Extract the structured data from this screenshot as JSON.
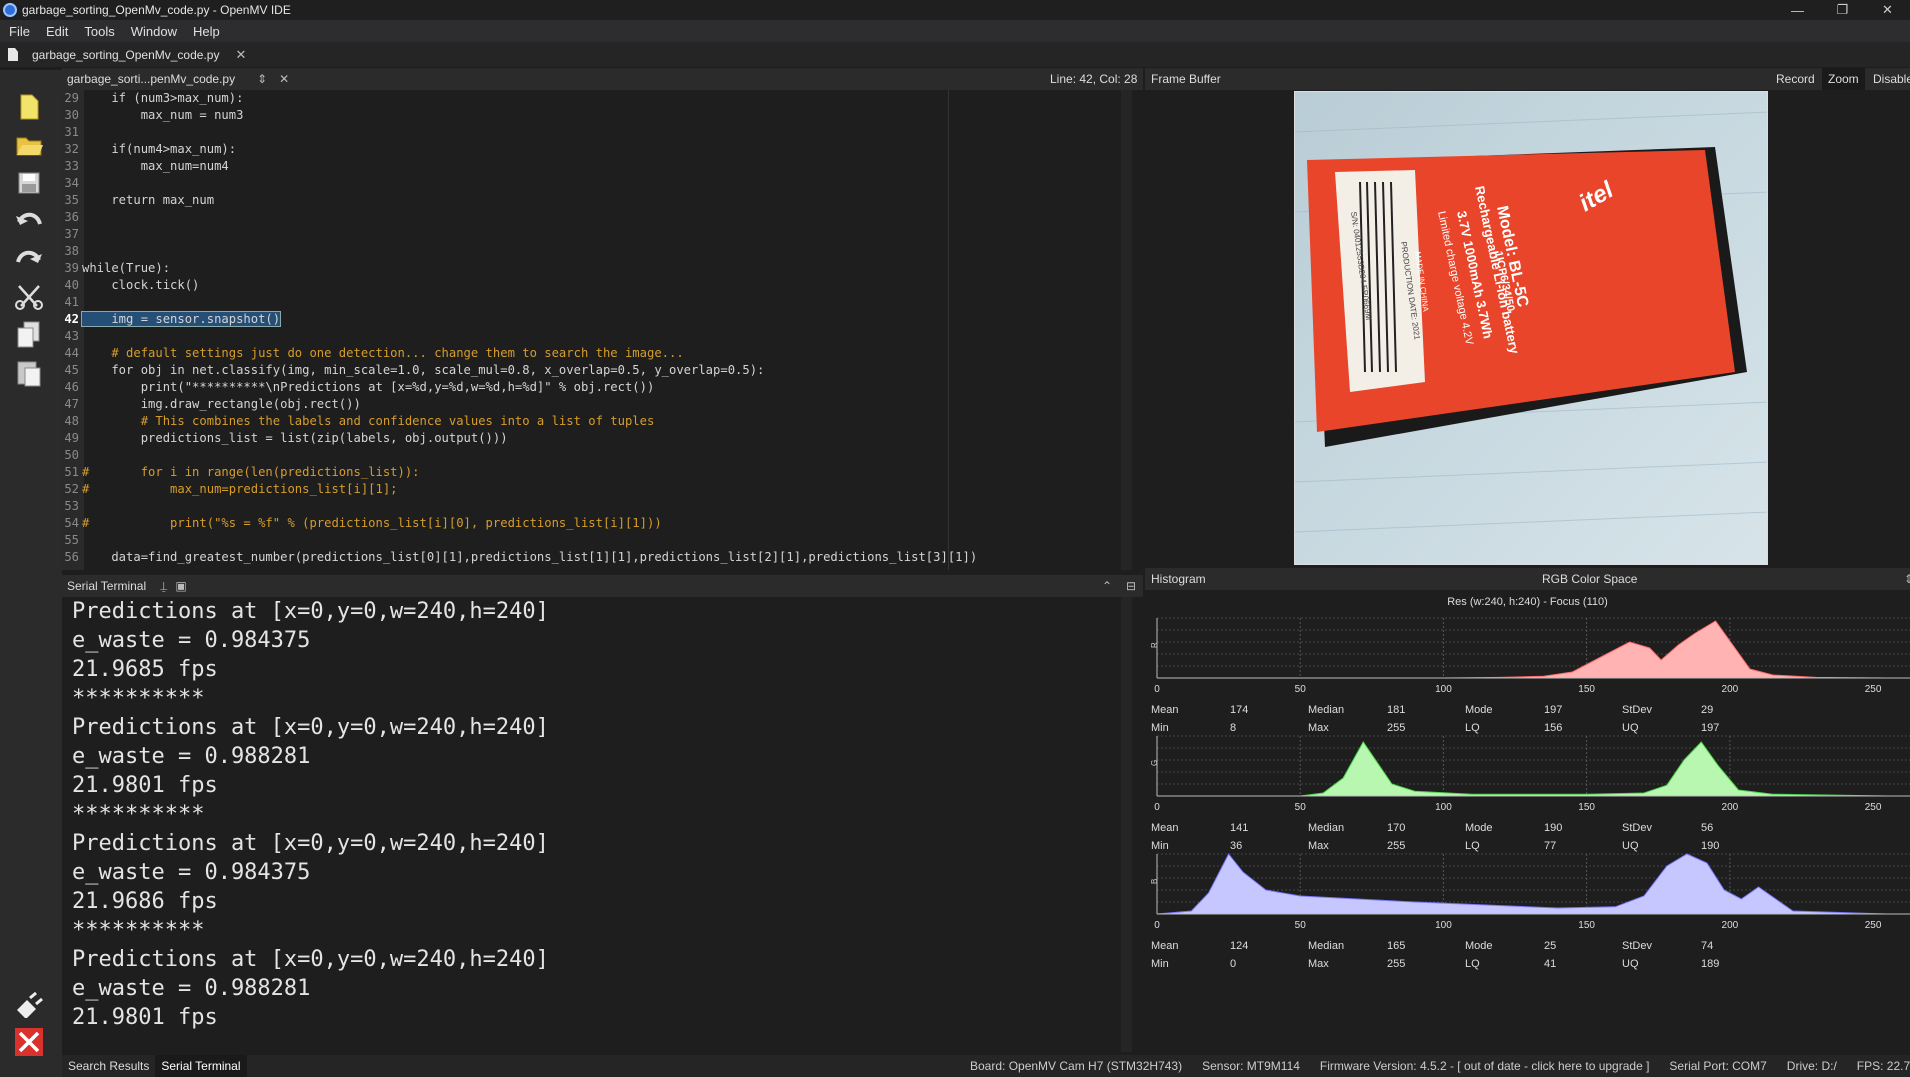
{
  "window": {
    "title": "garbage_sorting_OpenMv_code.py - OpenMV IDE",
    "min": "—",
    "max": "❐",
    "close": "✕"
  },
  "menu": [
    "File",
    "Edit",
    "Tools",
    "Window",
    "Help"
  ],
  "doc_tab": {
    "label": "garbage_sorting_OpenMv_code.py"
  },
  "editor": {
    "file_label": "garbage_sorti...penMv_code.py",
    "position": "Line: 42, Col: 28"
  },
  "code_lines": [
    {
      "n": "29",
      "t": "    if (num3>max_num):"
    },
    {
      "n": "30",
      "t": "        max_num = num3"
    },
    {
      "n": "31",
      "t": ""
    },
    {
      "n": "32",
      "t": "    if(num4>max_num):"
    },
    {
      "n": "33",
      "t": "        max_num=num4"
    },
    {
      "n": "34",
      "t": ""
    },
    {
      "n": "35",
      "t": "    return max_num"
    },
    {
      "n": "36",
      "t": ""
    },
    {
      "n": "37",
      "t": ""
    },
    {
      "n": "38",
      "t": ""
    },
    {
      "n": "39",
      "t": "while(True):"
    },
    {
      "n": "40",
      "t": "    clock.tick()"
    },
    {
      "n": "41",
      "t": ""
    },
    {
      "n": "42",
      "t": "    img = sensor.snapshot()"
    },
    {
      "n": "43",
      "t": ""
    },
    {
      "n": "44",
      "t": "    # default settings just do one detection... change them to search the image..."
    },
    {
      "n": "45",
      "t": "    for obj in net.classify(img, min_scale=1.0, scale_mul=0.8, x_overlap=0.5, y_overlap=0.5):"
    },
    {
      "n": "46",
      "t": "        print(\"**********\\nPredictions at [x=%d,y=%d,w=%d,h=%d]\" % obj.rect())"
    },
    {
      "n": "47",
      "t": "        img.draw_rectangle(obj.rect())"
    },
    {
      "n": "48",
      "t": "        # This combines the labels and confidence values into a list of tuples"
    },
    {
      "n": "49",
      "t": "        predictions_list = list(zip(labels, obj.output()))"
    },
    {
      "n": "50",
      "t": ""
    },
    {
      "n": "51",
      "t": "#       for i in range(len(predictions_list)):"
    },
    {
      "n": "52",
      "t": "#           max_num=predictions_list[i][1];"
    },
    {
      "n": "53",
      "t": ""
    },
    {
      "n": "54",
      "t": "#           print(\"%s = %f\" % (predictions_list[i][0], predictions_list[i][1]))"
    },
    {
      "n": "55",
      "t": ""
    },
    {
      "n": "56",
      "t": "    data=find_greatest_number(predictions_list[0][1],predictions_list[1][1],predictions_list[2][1],predictions_list[3][1])"
    }
  ],
  "terminal": {
    "title": "Serial Terminal",
    "lines": [
      "Predictions at [x=0,y=0,w=240,h=240]",
      "e_waste = 0.984375",
      "21.9685 fps",
      "**********",
      "Predictions at [x=0,y=0,w=240,h=240]",
      "e_waste = 0.988281",
      "21.9801 fps",
      "**********",
      "Predictions at [x=0,y=0,w=240,h=240]",
      "e_waste = 0.984375",
      "21.9686 fps",
      "**********",
      "Predictions at [x=0,y=0,w=240,h=240]",
      "e_waste = 0.988281",
      "21.9801 fps"
    ]
  },
  "bottom_tabs": [
    "Search Results",
    "Serial Terminal"
  ],
  "status": {
    "board": "Board: OpenMV Cam H7 (STM32H743)",
    "sensor": "Sensor: MT9M114",
    "firmware": "Firmware Version: 4.5.2 - [ out of date - click here to upgrade ]",
    "port": "Serial Port: COM7",
    "drive": "Drive: D:/",
    "fps": "FPS: 22.7"
  },
  "framebuffer": {
    "title": "Frame Buffer",
    "record": "Record",
    "zoom": "Zoom",
    "disable": "Disable"
  },
  "battery_label": {
    "model": "Model: BL-5C",
    "type": "Rechargeable Li-ion battery",
    "cell": "1ICP6/34/50",
    "spec": "3.7V 1000mAh 3.7Wh",
    "limit": "Limited charge voltage 4.2V",
    "sn": "S/N: 04012553B204 FR0669M",
    "prod": "PRODUCTION DATE: 2021",
    "made": "MADE IN CHINA",
    "brand": "itel"
  },
  "histogram": {
    "title": "Histogram",
    "space": "RGB Color Space",
    "res": "Res (w:240, h:240) - Focus (110)",
    "ticks": [
      "0",
      "50",
      "100",
      "150",
      "200",
      "250"
    ],
    "stat_names": {
      "mean": "Mean",
      "median": "Median",
      "mode": "Mode",
      "stdev": "StDev",
      "min": "Min",
      "max": "Max",
      "lq": "LQ",
      "uq": "UQ"
    },
    "channels": [
      {
        "name": "R",
        "color": "#ffb3b3",
        "stroke": "#ff6b6b",
        "mean": "174",
        "median": "181",
        "mode": "197",
        "stdev": "29",
        "min": "8",
        "max": "255",
        "lq": "156",
        "uq": "197",
        "points": [
          [
            0,
            0
          ],
          [
            100,
            0
          ],
          [
            120,
            1
          ],
          [
            135,
            3
          ],
          [
            145,
            10
          ],
          [
            155,
            35
          ],
          [
            165,
            60
          ],
          [
            172,
            50
          ],
          [
            176,
            30
          ],
          [
            182,
            55
          ],
          [
            188,
            75
          ],
          [
            195,
            95
          ],
          [
            201,
            55
          ],
          [
            207,
            15
          ],
          [
            215,
            5
          ],
          [
            230,
            1
          ],
          [
            255,
            0
          ]
        ]
      },
      {
        "name": "G",
        "color": "#b8f7b0",
        "stroke": "#4cd64c",
        "mean": "141",
        "median": "170",
        "mode": "190",
        "stdev": "56",
        "min": "36",
        "max": "255",
        "lq": "77",
        "uq": "190",
        "points": [
          [
            0,
            0
          ],
          [
            50,
            0
          ],
          [
            58,
            5
          ],
          [
            65,
            30
          ],
          [
            72,
            90
          ],
          [
            76,
            62
          ],
          [
            82,
            20
          ],
          [
            90,
            8
          ],
          [
            110,
            3
          ],
          [
            150,
            3
          ],
          [
            170,
            5
          ],
          [
            178,
            18
          ],
          [
            184,
            60
          ],
          [
            190,
            90
          ],
          [
            196,
            50
          ],
          [
            203,
            10
          ],
          [
            215,
            3
          ],
          [
            255,
            0
          ]
        ]
      },
      {
        "name": "B",
        "color": "#c7c7ff",
        "stroke": "#7878ff",
        "mean": "124",
        "median": "165",
        "mode": "25",
        "stdev": "74",
        "min": "0",
        "max": "255",
        "lq": "41",
        "uq": "189",
        "points": [
          [
            0,
            0
          ],
          [
            12,
            5
          ],
          [
            18,
            35
          ],
          [
            25,
            100
          ],
          [
            30,
            70
          ],
          [
            38,
            40
          ],
          [
            50,
            30
          ],
          [
            90,
            20
          ],
          [
            140,
            10
          ],
          [
            160,
            12
          ],
          [
            170,
            30
          ],
          [
            178,
            80
          ],
          [
            185,
            100
          ],
          [
            192,
            85
          ],
          [
            198,
            40
          ],
          [
            204,
            25
          ],
          [
            210,
            45
          ],
          [
            216,
            25
          ],
          [
            222,
            5
          ],
          [
            255,
            0
          ]
        ]
      }
    ]
  }
}
